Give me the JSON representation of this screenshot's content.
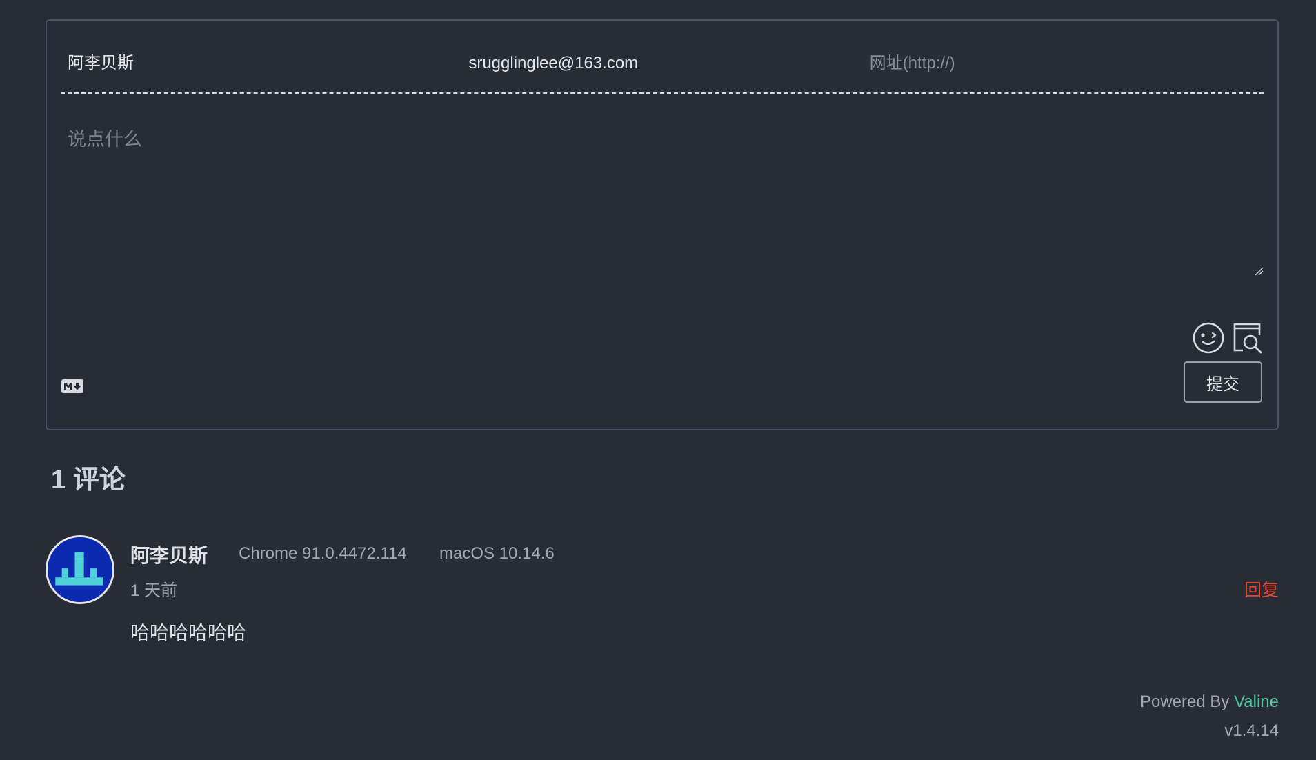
{
  "form": {
    "nickname": "阿李贝斯",
    "email": "srugglinglee@163.com",
    "website_placeholder": "网址(http://)",
    "comment_placeholder": "说点什么",
    "submit_label": "提交",
    "icons": [
      "emoji-icon",
      "preview-icon",
      "markdown-icon"
    ]
  },
  "comments": {
    "count_title": "1 评论",
    "items": [
      {
        "author": "阿李贝斯",
        "browser": "Chrome 91.0.4472.114",
        "os": "macOS 10.14.6",
        "time": "1 天前",
        "reply_label": "回复",
        "content": "哈哈哈哈哈哈"
      }
    ]
  },
  "footer": {
    "powered_by": "Powered By ",
    "brand": "Valine",
    "version": "v1.4.14"
  },
  "colors": {
    "background": "#272c36",
    "reply": "#e24b33",
    "brand": "#4fc4a9",
    "avatar_bg": "#0c2bb0",
    "avatar_fg": "#4fd2d8"
  }
}
